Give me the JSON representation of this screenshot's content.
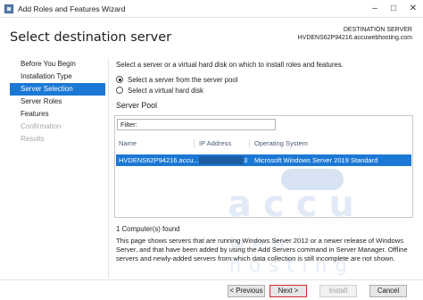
{
  "window": {
    "title": "Add Roles and Features Wizard",
    "minimize_glyph": "–",
    "maximize_glyph": "□",
    "close_glyph": "✕"
  },
  "header": {
    "page_title": "Select destination server",
    "destination_label": "DESTINATION SERVER",
    "destination_value": "HVDENS62P94216.accuwebhosting.com"
  },
  "nav": {
    "items": [
      {
        "label": "Before You Begin",
        "state": "normal"
      },
      {
        "label": "Installation Type",
        "state": "normal"
      },
      {
        "label": "Server Selection",
        "state": "active"
      },
      {
        "label": "Server Roles",
        "state": "normal"
      },
      {
        "label": "Features",
        "state": "normal"
      },
      {
        "label": "Confirmation",
        "state": "disabled"
      },
      {
        "label": "Results",
        "state": "disabled"
      }
    ]
  },
  "main": {
    "intro": "Select a server or a virtual hard disk on which to install roles and features.",
    "options": [
      {
        "label": "Select a server from the server pool",
        "checked": true
      },
      {
        "label": "Select a virtual hard disk",
        "checked": false
      }
    ],
    "pool_label": "Server Pool",
    "filter_label": "Filter:",
    "filter_value": "",
    "columns": [
      "Name",
      "IP Address",
      "Operating System"
    ],
    "rows": [
      {
        "name": "HVDENS62P94216.accu...",
        "ip_tail": "3",
        "os": "Microsoft Windows Server 2019 Standard"
      }
    ],
    "count": "1 Computer(s) found",
    "description": "This page shows servers that are running Windows Server 2012 or a newer release of Windows Server, and that have been added by using the Add Servers command in Server Manager. Offline servers and newly-added servers from which data collection is still incomplete are not shown."
  },
  "watermark": {
    "main": "accu",
    "sub": "web hosting"
  },
  "footer": {
    "previous_label": "< Previous",
    "next_label": "Next >",
    "install_label": "Install",
    "cancel_label": "Cancel"
  },
  "colors": {
    "accent": "#1b78d4",
    "highlight_border": "#d8262f"
  }
}
